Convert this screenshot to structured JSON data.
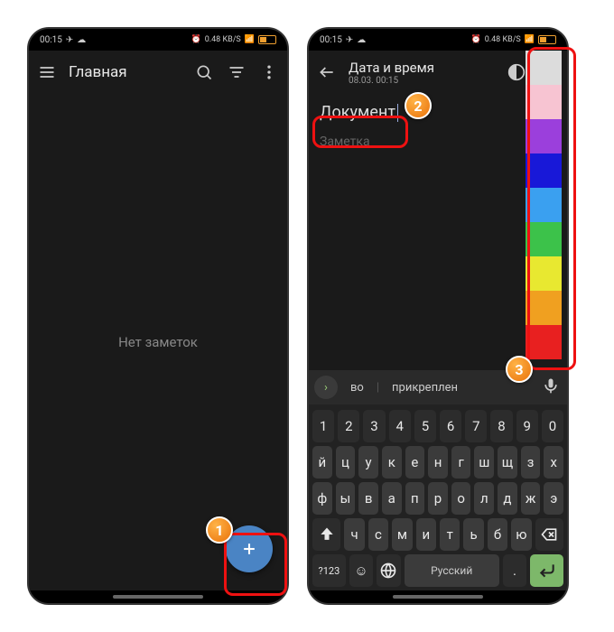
{
  "status": {
    "time": "00:15",
    "net": "0.48 KB/S"
  },
  "screen1": {
    "title": "Главная",
    "empty_text": "Нет заметок"
  },
  "screen2": {
    "header_title": "Дата и время",
    "header_date": "08.03.         00:15",
    "note_title_value": "Документ",
    "note_body_placeholder": "Заметка",
    "theme_label": "A",
    "suggestions": {
      "s1": "во",
      "s2": "прикреплен"
    },
    "colors": [
      "#dcdcdc",
      "#f7c4d2",
      "#9b3fdc",
      "#1818d8",
      "#3aa0f0",
      "#3cc24a",
      "#e8e830",
      "#f0a020",
      "#e82020"
    ]
  },
  "keyboard": {
    "row_num": [
      "1",
      "2",
      "3",
      "4",
      "5",
      "6",
      "7",
      "8",
      "9",
      "0"
    ],
    "row1": [
      "й",
      "ц",
      "у",
      "к",
      "е",
      "н",
      "г",
      "ш",
      "щ",
      "з",
      "х"
    ],
    "row2": [
      "ф",
      "ы",
      "в",
      "а",
      "п",
      "р",
      "о",
      "л",
      "д",
      "ж",
      "э"
    ],
    "row3": [
      "ч",
      "с",
      "м",
      "и",
      "т",
      "ь",
      "б",
      "ю"
    ],
    "sym": "?123",
    "space": "Русский",
    "dot": "."
  },
  "badges": {
    "b1": "1",
    "b2": "2",
    "b3": "3"
  }
}
